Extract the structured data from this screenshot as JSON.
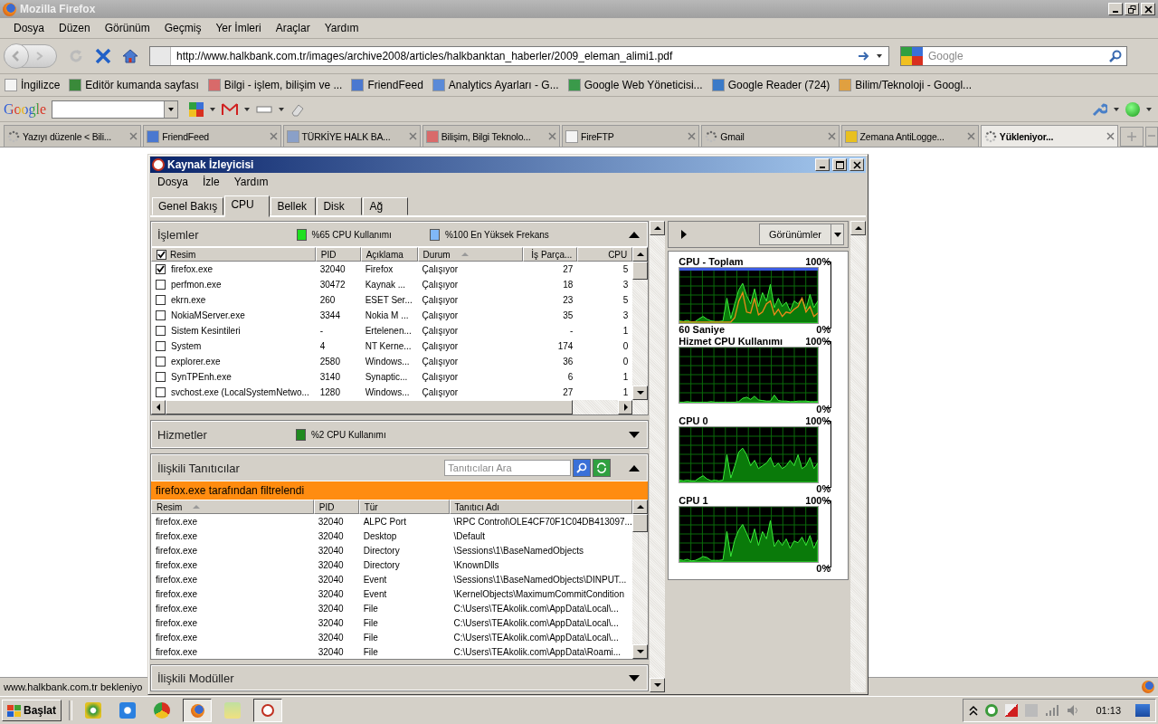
{
  "browser": {
    "title": "Mozilla Firefox",
    "menu": [
      "Dosya",
      "Düzen",
      "Görünüm",
      "Geçmiş",
      "Yer İmleri",
      "Araçlar",
      "Yardım"
    ],
    "url": "http://www.halkbank.com.tr/images/archive2008/articles/halkbanktan_haberler/2009_eleman_alimi1.pdf",
    "search_placeholder": "Google",
    "bookmarks": [
      {
        "label": "İngilizce",
        "kind": "page"
      },
      {
        "label": "Editör kumanda sayfası",
        "kind": "dino"
      },
      {
        "label": "Bilgi - işlem, bilişim ve ...",
        "kind": "cup"
      },
      {
        "label": "FriendFeed",
        "kind": "feed"
      },
      {
        "label": "Analytics Ayarları - G...",
        "kind": "chart"
      },
      {
        "label": "Google Web Yöneticisi...",
        "kind": "google"
      },
      {
        "label": "Google Reader (724)",
        "kind": "reader"
      },
      {
        "label": "Bilim/Teknoloji - Googl...",
        "kind": "news"
      }
    ],
    "toolbar_logo": "Google",
    "tabs": [
      {
        "label": "Yazıyı düzenle < Bili...",
        "kind": "spinner",
        "selected": false
      },
      {
        "label": "FriendFeed",
        "kind": "feed",
        "selected": false
      },
      {
        "label": "TÜRKİYE HALK BA...",
        "kind": "signal",
        "selected": false
      },
      {
        "label": "Bilişim, Bilgi Teknolo...",
        "kind": "cup",
        "selected": false
      },
      {
        "label": "FireFTP",
        "kind": "page",
        "selected": false
      },
      {
        "label": "Gmail",
        "kind": "spinner",
        "selected": false
      },
      {
        "label": "Zemana AntiLogge...",
        "kind": "shield",
        "selected": false
      },
      {
        "label": "Yükleniyor...",
        "kind": "spinner",
        "selected": true
      }
    ],
    "status": "www.halkbank.com.tr bekleniyo"
  },
  "monitor": {
    "title": "Kaynak İzleyicisi",
    "menu": [
      "Dosya",
      "İzle",
      "Yardım"
    ],
    "tabs": [
      {
        "label": "Genel Bakış",
        "selected": false
      },
      {
        "label": "CPU",
        "selected": true
      },
      {
        "label": "Bellek",
        "selected": false
      },
      {
        "label": "Disk",
        "selected": false
      },
      {
        "label": "Ağ",
        "selected": false
      }
    ],
    "processes": {
      "title": "İşlemler",
      "usage": "%65 CPU Kullanımı",
      "frequency": "%100 En Yüksek Frekans",
      "expanded": true,
      "all_checked": true,
      "columns": [
        {
          "label": "Resim",
          "sorted": false
        },
        {
          "label": "PID",
          "sorted": false
        },
        {
          "label": "Açıklama",
          "sorted": false
        },
        {
          "label": "Durum",
          "sorted": true
        },
        {
          "label": "İş Parça...",
          "sorted": false
        },
        {
          "label": "CPU",
          "sorted": false
        }
      ],
      "rows": [
        {
          "checked": true,
          "cells": [
            "firefox.exe",
            "32040",
            "Firefox",
            "Çalışıyor",
            "27",
            "5"
          ]
        },
        {
          "checked": false,
          "cells": [
            "perfmon.exe",
            "30472",
            "Kaynak ...",
            "Çalışıyor",
            "18",
            "3"
          ]
        },
        {
          "checked": false,
          "cells": [
            "ekrn.exe",
            "260",
            "ESET Ser...",
            "Çalışıyor",
            "23",
            "5"
          ]
        },
        {
          "checked": false,
          "cells": [
            "NokiaMServer.exe",
            "3344",
            "Nokia M ...",
            "Çalışıyor",
            "35",
            "3"
          ]
        },
        {
          "checked": false,
          "cells": [
            "Sistem Kesintileri",
            "-",
            "Ertelenen...",
            "Çalışıyor",
            "-",
            "1"
          ]
        },
        {
          "checked": false,
          "cells": [
            "System",
            "4",
            "NT Kerne...",
            "Çalışıyor",
            "174",
            "0"
          ]
        },
        {
          "checked": false,
          "cells": [
            "explorer.exe",
            "2580",
            "Windows...",
            "Çalışıyor",
            "36",
            "0"
          ]
        },
        {
          "checked": false,
          "cells": [
            "SynTPEnh.exe",
            "3140",
            "Synaptic...",
            "Çalışıyor",
            "6",
            "1"
          ]
        },
        {
          "checked": false,
          "cells": [
            "svchost.exe (LocalSystemNetwo...",
            "1280",
            "Windows...",
            "Çalışıyor",
            "27",
            "1"
          ]
        }
      ]
    },
    "services": {
      "title": "Hizmetler",
      "usage": "%2 CPU Kullanımı",
      "expanded": false
    },
    "handles": {
      "title": "İlişkili Tanıtıcılar",
      "search_placeholder": "Tanıtıcıları Ara",
      "expanded": true,
      "filter": "firefox.exe tarafından filtrelendi",
      "columns": [
        {
          "label": "Resim",
          "sorted": true
        },
        {
          "label": "PID",
          "sorted": false
        },
        {
          "label": "Tür",
          "sorted": false
        },
        {
          "label": "Tanıtıcı Adı",
          "sorted": false
        }
      ],
      "rows": [
        [
          "firefox.exe",
          "32040",
          "ALPC Port",
          "\\RPC Control\\OLE4CF70F1C04DB413097..."
        ],
        [
          "firefox.exe",
          "32040",
          "Desktop",
          "\\Default"
        ],
        [
          "firefox.exe",
          "32040",
          "Directory",
          "\\Sessions\\1\\BaseNamedObjects"
        ],
        [
          "firefox.exe",
          "32040",
          "Directory",
          "\\KnownDlls"
        ],
        [
          "firefox.exe",
          "32040",
          "Event",
          "\\Sessions\\1\\BaseNamedObjects\\DINPUT..."
        ],
        [
          "firefox.exe",
          "32040",
          "Event",
          "\\KernelObjects\\MaximumCommitCondition"
        ],
        [
          "firefox.exe",
          "32040",
          "File",
          "C:\\Users\\TEAkolik.com\\AppData\\Local\\..."
        ],
        [
          "firefox.exe",
          "32040",
          "File",
          "C:\\Users\\TEAkolik.com\\AppData\\Local\\..."
        ],
        [
          "firefox.exe",
          "32040",
          "File",
          "C:\\Users\\TEAkolik.com\\AppData\\Local\\..."
        ],
        [
          "firefox.exe",
          "32040",
          "File",
          "C:\\Users\\TEAkolik.com\\AppData\\Roami..."
        ]
      ]
    },
    "modules": {
      "title": "İlişkili Modüller",
      "expanded": false
    },
    "views_button": "Görünümler",
    "graphs": [
      {
        "kind": "total",
        "title": "CPU - Toplam",
        "max": "100%",
        "min": "0%",
        "footer": "60 Saniye"
      },
      {
        "kind": "cpu",
        "title": "Hizmet CPU Kullanımı",
        "max": "100%",
        "min": "0%"
      },
      {
        "kind": "cpu",
        "title": "CPU 0",
        "max": "100%",
        "min": "0%"
      },
      {
        "kind": "cpu",
        "title": "CPU 1",
        "max": "100%",
        "min": "0%"
      }
    ]
  },
  "taskbar": {
    "start": "Başlat",
    "clock": "01:13"
  }
}
